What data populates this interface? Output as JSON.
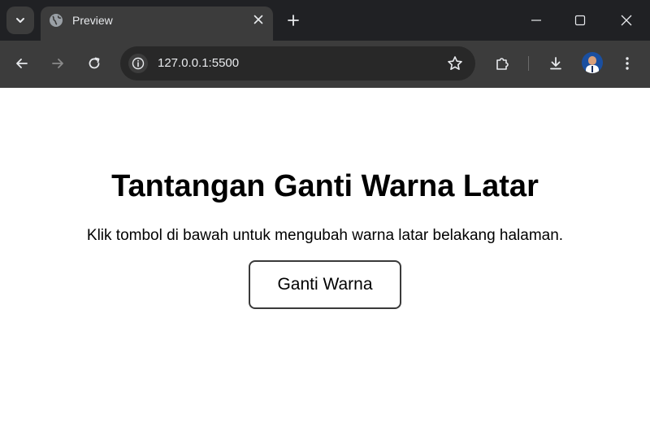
{
  "browser": {
    "tab": {
      "title": "Preview",
      "favicon": "globe-icon"
    },
    "address_bar": {
      "url": "127.0.0.1:5500"
    },
    "icons": {
      "tab_search": "chevron-down-icon",
      "close_tab": "close-icon",
      "new_tab": "plus-icon",
      "minimize": "minimize-icon",
      "maximize": "maximize-icon",
      "close_window": "close-icon",
      "back": "arrow-left-icon",
      "forward": "arrow-right-icon",
      "reload": "reload-icon",
      "site_info": "info-icon",
      "bookmark": "star-icon",
      "extensions": "puzzle-icon",
      "downloads": "download-icon",
      "profile": "avatar-icon",
      "menu": "more-vertical-icon"
    },
    "colors": {
      "tabstrip_bg": "#202124",
      "toolbar_bg": "#3c3c3c",
      "omnibox_bg": "#282828",
      "icon_color": "#e8eaed"
    }
  },
  "page": {
    "heading": "Tantangan Ganti Warna Latar",
    "description": "Klik tombol di bawah untuk mengubah warna latar belakang halaman.",
    "button_label": "Ganti Warna",
    "background_color": "#ffffff"
  }
}
